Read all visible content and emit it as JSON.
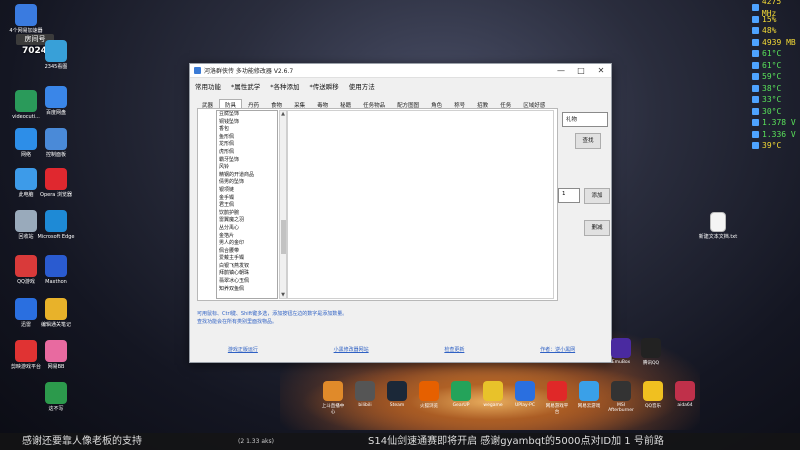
{
  "stream": {
    "room_label": "房间号",
    "room_number": "70249"
  },
  "hw_monitor": [
    {
      "value": "4275 MHz",
      "color": "yellow"
    },
    {
      "value": "15%",
      "color": "yellow"
    },
    {
      "value": "48%",
      "color": "yellow"
    },
    {
      "value": "4939 MB",
      "color": "yellow"
    },
    {
      "value": "61°C",
      "color": "green"
    },
    {
      "value": "61°C",
      "color": "green"
    },
    {
      "value": "59°C",
      "color": "green"
    },
    {
      "value": "38°C",
      "color": "green"
    },
    {
      "value": "33°C",
      "color": "green"
    },
    {
      "value": "30°C",
      "color": "green"
    },
    {
      "value": "1.378 V",
      "color": "green"
    },
    {
      "value": "1.336 V",
      "color": "green"
    },
    {
      "value": "39°C",
      "color": "yellow"
    }
  ],
  "desktop_icons": [
    {
      "label": "4个网易加速器",
      "icon": "app-icon",
      "color": "#3a7be0"
    },
    {
      "label": "videocuti...",
      "icon": "video-icon",
      "color": "#2a9a5a"
    },
    {
      "label": "网络",
      "icon": "network-icon",
      "color": "#2d8ee8"
    },
    {
      "label": "控制面板",
      "icon": "control-panel-icon",
      "color": "#4a8ad8"
    },
    {
      "label": "此电脑",
      "icon": "computer-icon",
      "color": "#3d9be9"
    },
    {
      "label": "QQ游戏",
      "icon": "game-icon",
      "color": "#d93a3a"
    },
    {
      "label": "迅雷",
      "icon": "thunder-icon",
      "color": "#2a6fe0"
    },
    {
      "label": "剪映游戏平台",
      "icon": "game-platform-icon",
      "color": "#e03333"
    },
    {
      "label": "2345看图",
      "icon": "viewer-icon",
      "color": "#38a0d8"
    },
    {
      "label": "百度网盘",
      "icon": "cloud-icon",
      "color": "#3a86e8"
    },
    {
      "label": "回收站",
      "icon": "recycle-bin-icon",
      "color": "#9ab"
    },
    {
      "label": "Opera 浏览器",
      "icon": "opera-icon",
      "color": "#e0282f"
    },
    {
      "label": "Microsoft Edge",
      "icon": "edge-icon",
      "color": "#1e8ad6"
    },
    {
      "label": "Maxthon",
      "icon": "maxthon-icon",
      "color": "#2a5bd0"
    },
    {
      "label": "编辑通关笔记",
      "icon": "notes-icon",
      "color": "#e8b22a"
    },
    {
      "label": "网易BB",
      "icon": "lala-icon",
      "color": "#e86aa0"
    },
    {
      "label": "这不写",
      "icon": "excel-icon",
      "color": "#2c9a4c"
    }
  ],
  "window": {
    "title": "河洛群侠传 多功能修改器 V2.6.7",
    "minimize": "—",
    "maximize": "□",
    "close": "✕",
    "menu": [
      "常用功能",
      "*属性武学",
      "*各种添加",
      "*传送瞬移",
      "使用方法"
    ],
    "tabs": [
      "武器",
      "防具",
      "丹药",
      "食物",
      "采集",
      "毒物",
      "秘籍",
      "任务物品",
      "配方图图",
      "角色",
      "称号",
      "招教",
      "任务",
      "区域好感"
    ],
    "active_tab_index": 1,
    "list_items": [
      "豆腐坠饰",
      "铜钱坠饰",
      "香包",
      "鱼形佩",
      "龙形佩",
      "虎形佩",
      "霸牙坠饰",
      "风铃",
      "精钢的开道商品",
      "倩男的坠饰",
      "银项链",
      "金手镯",
      "君王佩",
      "饮鹊护腕",
      "雷翼魔之羽",
      "丛分禹心",
      "金箔片",
      "男人的金印",
      "佩合腰带",
      "爱戴主手镯",
      "白银飞燕发钗",
      "拜鹊镇心朝珠",
      "翡翠冰心玉佩",
      "知养双鱼佩"
    ],
    "scroll_position": 0.72,
    "search_value": "礼物",
    "find_button": "查找",
    "quantity_value": "1",
    "add_button": "添加",
    "clear_button": "删减",
    "hint_line1": "可用鼠标、Ctrl键、Shift键多选，添加按钮左边的数字是添加数量。",
    "hint_line2": "查找功能会在所有类别里面找物品。",
    "links": [
      "游戏正版运行",
      "小黑修改器网站",
      "检查更新",
      "作者：逆小黑网"
    ]
  },
  "dock": [
    {
      "label": "上斗直播中心",
      "icon": "stream-icon",
      "color": "#e08a2a"
    },
    {
      "label": "bilibili",
      "icon": "calculator-icon",
      "color": "#555"
    },
    {
      "label": "Steam",
      "icon": "steam-icon",
      "color": "#1b2838"
    },
    {
      "label": "火狐浏览",
      "icon": "firefox-icon",
      "color": "#e66000"
    },
    {
      "label": "GearUP",
      "icon": "gearup-icon",
      "color": "#24a35a"
    },
    {
      "label": "wegame",
      "icon": "wegame-icon",
      "color": "#e8c22a"
    },
    {
      "label": "UPlay-PC",
      "icon": "uplay-icon",
      "color": "#2a6fe0"
    },
    {
      "label": "网易游戏平台",
      "icon": "netease-icon",
      "color": "#e02828"
    },
    {
      "label": "网易云游戏",
      "icon": "cloud-game-icon",
      "color": "#3aa0e8"
    },
    {
      "label": "MSI Afterburner",
      "icon": "msi-icon",
      "color": "#333"
    },
    {
      "label": "QQ音乐",
      "icon": "qqmusic-icon",
      "color": "#f0c020"
    },
    {
      "label": "aida64",
      "icon": "aida64-icon",
      "color": "#c0304a"
    }
  ],
  "dock_right": [
    {
      "label": "EmuBox",
      "icon": "emu-icon",
      "color": "#4a2aa0"
    },
    {
      "label": "腾讯QQ",
      "icon": "qq-icon",
      "color": "#222"
    }
  ],
  "ticker": {
    "left": "感谢还要靠人像老板的支持",
    "small": "(2 1.33 aks)",
    "right": "S14仙剑速通赛即将开启 感谢gyambqt的5000点对ID加 1 号前路"
  },
  "desk_file": {
    "label": "新建文本文档.txt",
    "icon": "text-file-icon"
  }
}
